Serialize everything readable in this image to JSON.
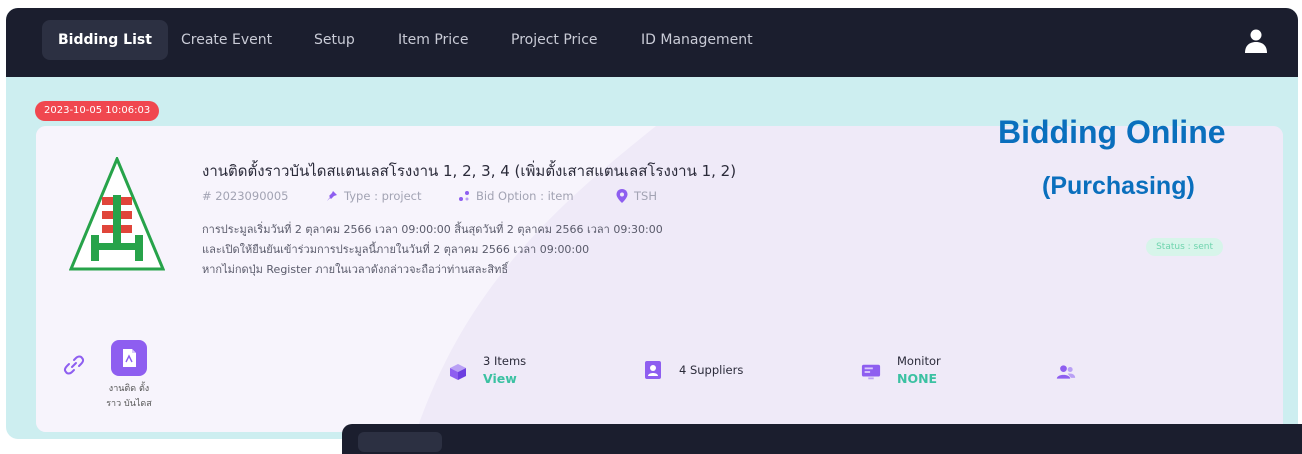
{
  "nav": {
    "items": [
      {
        "label": "Bidding List",
        "active": true
      },
      {
        "label": "Create Event"
      },
      {
        "label": "Setup"
      },
      {
        "label": "Item Price"
      },
      {
        "label": "Project Price"
      },
      {
        "label": "ID Management"
      }
    ],
    "user_icon": "user-icon"
  },
  "event": {
    "date_badge": "2023-10-05 10:06:03",
    "title": "งานติดตั้งราวบันไดสแตนเลสโรงงาน 1, 2, 3, 4 (เพิ่มตั้งเสาสแตนเลสโรงงาน 1, 2)",
    "id": "# 2023090005",
    "type": "Type : project",
    "bid_option": "Bid Option : item",
    "location": "TSH",
    "desc_line1": "การประมูลเริ่มวันที่ 2 ตุลาคม 2566 เวลา 09:00:00 สิ้นสุดวันที่ 2 ตุลาคม 2566 เวลา 09:30:00",
    "desc_line2": "และเปิดให้ยืนยันเข้าร่วมการประมูลนี้ภายในวันที่ 2 ตุลาคม 2566 เวลา 09:00:00",
    "desc_line3": "หากไม่กดปุ่ม Register ภายในเวลาดังกล่าวจะถือว่าท่านสละสิทธิ์",
    "status": "Status : sent",
    "doc_label": "งานติด ตั้งราว บันไดส"
  },
  "promo": {
    "title": "Bidding Online",
    "subtitle": "(Purchasing)"
  },
  "stats": {
    "items_label": "3 Items",
    "items_action": "View",
    "suppliers_label": "4 Suppliers",
    "monitor_label": "Monitor",
    "monitor_value": "NONE"
  },
  "colors": {
    "nav_bg": "#1b1e2e",
    "page_bg": "#cdeef0",
    "card_bg": "#efeaf8",
    "accent_purple": "#8e5ef0",
    "badge_red": "#f0474f",
    "teal_value": "#3bc1a2",
    "promo_blue": "#0a6fbd"
  }
}
